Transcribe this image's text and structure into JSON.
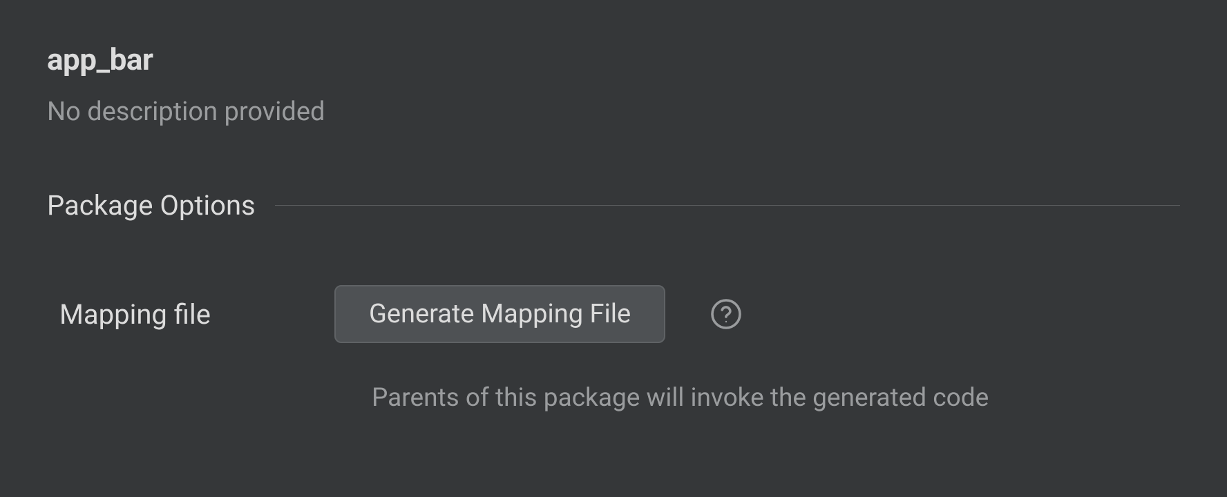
{
  "package": {
    "title": "app_bar",
    "description": "No description provided"
  },
  "section": {
    "title": "Package Options"
  },
  "options": {
    "mapping_file": {
      "label": "Mapping file",
      "button_label": "Generate Mapping File",
      "hint": "Parents of this package will invoke the generated code"
    }
  }
}
